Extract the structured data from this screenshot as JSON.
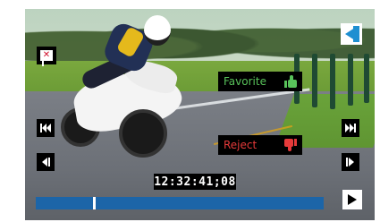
{
  "overlay": {
    "favorite_label": "Favorite",
    "reject_label": "Reject",
    "timecode": "12:32:41;08"
  },
  "timeline": {
    "playhead_fraction": 0.2
  },
  "icons": {
    "unflag": "flag-x-icon",
    "back": "back-chevron-icon",
    "skip_start": "skip-to-start-icon",
    "skip_end": "skip-to-end-icon",
    "step_back": "step-back-icon",
    "step_forward": "step-forward-icon",
    "play": "play-icon",
    "thumbs_up": "thumbs-up-icon",
    "thumbs_down": "thumbs-down-icon"
  },
  "colors": {
    "favorite": "#58c25a",
    "reject": "#e63a3a",
    "timeline": "#1c65a8",
    "back_accent": "#1e8fd1"
  }
}
